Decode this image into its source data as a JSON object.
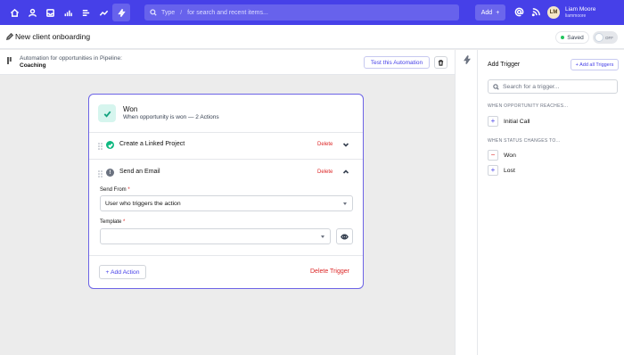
{
  "nav": {
    "icons": [
      "home-icon",
      "user-icon",
      "inbox-icon",
      "chart-icon",
      "list-icon",
      "trend-icon",
      "bolt-icon"
    ],
    "search_label": "Type",
    "search_hint": "for search and recent items...",
    "add_label": "Add",
    "user_name": "Liam Moore",
    "user_handle": "liammoore",
    "avatar_initials": "LM",
    "accent": "#4640e8"
  },
  "header": {
    "title": "New client onboarding",
    "saved_label": "Saved",
    "toggle_label": "OFF"
  },
  "subheader": {
    "line1": "Automation for opportunities in Pipeline:",
    "line2": "Coaching",
    "test_label": "Test this Automation"
  },
  "card": {
    "title": "Won",
    "subtitle": "When opportunity is won — 2 Actions",
    "actions": [
      {
        "label": "Create a Linked Project",
        "delete_label": "Delete",
        "status": "green"
      },
      {
        "label": "Send an Email",
        "delete_label": "Delete",
        "status": "grey"
      }
    ],
    "send_from_label": "Send From",
    "send_from_value": "User who triggers the action",
    "template_label": "Template",
    "template_value": "",
    "add_action_label": "+ Add Action",
    "delete_trigger_label": "Delete Trigger"
  },
  "right_panel": {
    "title": "Add Trigger",
    "add_all_label": "+ Add all Triggers",
    "search_placeholder": "Search for a trigger...",
    "section1": "WHEN OPPORTUNITY REACHES...",
    "section1_items": [
      "Initial Call"
    ],
    "section2": "WHEN STATUS CHANGES TO...",
    "section2_items": [
      {
        "label": "Won",
        "state": "added"
      },
      {
        "label": "Lost",
        "state": "available"
      }
    ]
  }
}
